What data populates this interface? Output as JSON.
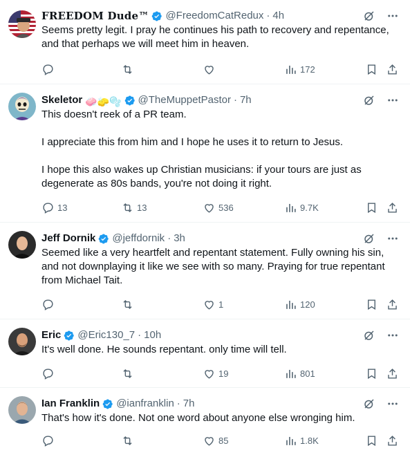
{
  "colors": {
    "text": "#0f1419",
    "muted": "#536471",
    "verified": "#1d9bf0",
    "border": "#eff3f4"
  },
  "tweets": [
    {
      "display_name": "𝐅𝐑𝐄𝐄𝐃𝐎𝐌 𝐃𝐮𝐝𝐞™",
      "handle": "@FreedomCatRedux",
      "time": "4h",
      "text": [
        "Seems pretty legit. I pray he continues his path to recovery and repentance, and that perhaps we will meet him in heaven."
      ],
      "replies": "",
      "retweets": "",
      "likes": "",
      "views": "172"
    },
    {
      "display_name": "Skeletor",
      "name_emoji": "🧼🧽🫧",
      "handle": "@TheMuppetPastor",
      "time": "7h",
      "text": [
        "This doesn't reek of a PR team.",
        "I appreciate this from him and I hope he uses it to return to Jesus.",
        "I hope this also wakes up Christian musicians:  if your tours are just as degenerate as 80s bands, you're not doing it right."
      ],
      "replies": "13",
      "retweets": "13",
      "likes": "536",
      "views": "9.7K"
    },
    {
      "display_name": "Jeff Dornik",
      "handle": "@jeffdornik",
      "time": "3h",
      "text": [
        "Seemed like a very heartfelt and repentant statement. Fully owning his sin, and not downplaying it like we see with so many. Praying for true repentant from Michael Tait."
      ],
      "replies": "",
      "retweets": "",
      "likes": "1",
      "views": "120"
    },
    {
      "display_name": "Eric",
      "handle": "@Eric130_7",
      "time": "10h",
      "text": [
        "It's well done. He sounds repentant. only time will tell."
      ],
      "replies": "",
      "retweets": "",
      "likes": "19",
      "views": "801"
    },
    {
      "display_name": "Ian Franklin",
      "handle": "@ianfranklin",
      "time": "7h",
      "text": [
        "That's how it's done. Not one word about anyone else wronging him."
      ],
      "replies": "",
      "retweets": "",
      "likes": "85",
      "views": "1.8K"
    }
  ]
}
